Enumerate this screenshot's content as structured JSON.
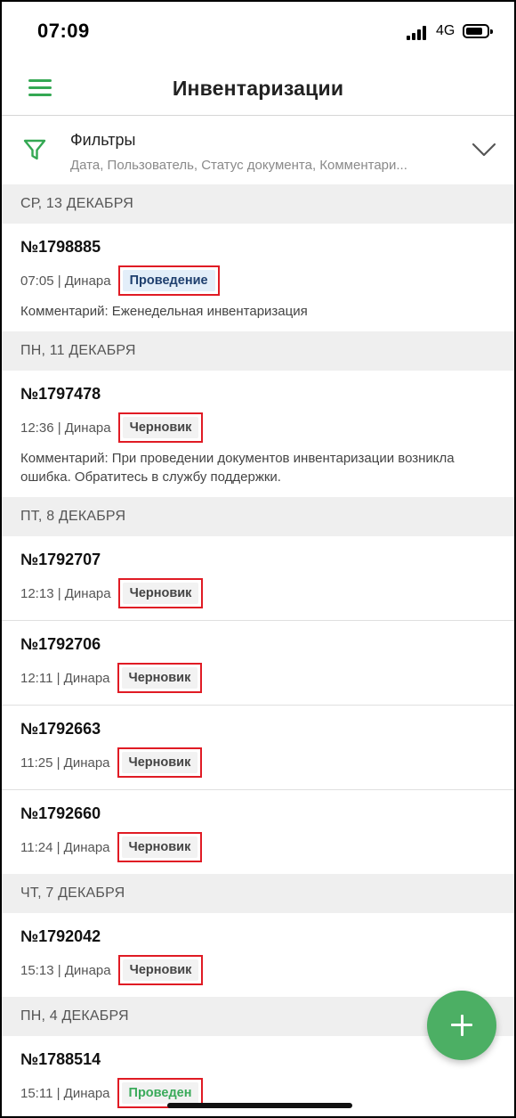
{
  "status_bar": {
    "time": "07:09",
    "network": "4G"
  },
  "app_bar": {
    "title": "Инвентаризации",
    "menu_icon": "hamburger-menu-icon"
  },
  "filters": {
    "title": "Фильтры",
    "subtitle": "Дата, Пользователь, Статус документа, Комментари...",
    "icon": "filter-icon"
  },
  "colors": {
    "accent": "#34a853",
    "fab": "#4caf64",
    "highlight": "#e01b24"
  },
  "groups": [
    {
      "date": "СР, 13 ДЕКАБРЯ",
      "items": [
        {
          "number": "№1798885",
          "meta": "07:05 | Динара",
          "status": "Проведение",
          "status_kind": "processing",
          "comment": "Комментарий: Еженедельная инвентаризация"
        }
      ]
    },
    {
      "date": "ПН, 11 ДЕКАБРЯ",
      "items": [
        {
          "number": "№1797478",
          "meta": "12:36 | Динара",
          "status": "Черновик",
          "status_kind": "draft",
          "comment": "Комментарий: При проведении документов инвентаризации возникла ошибка. Обратитесь в службу поддержки."
        }
      ]
    },
    {
      "date": "ПТ, 8 ДЕКАБРЯ",
      "items": [
        {
          "number": "№1792707",
          "meta": "12:13 | Динара",
          "status": "Черновик",
          "status_kind": "draft",
          "comment": ""
        },
        {
          "number": "№1792706",
          "meta": "12:11 | Динара",
          "status": "Черновик",
          "status_kind": "draft",
          "comment": ""
        },
        {
          "number": "№1792663",
          "meta": "11:25 | Динара",
          "status": "Черновик",
          "status_kind": "draft",
          "comment": ""
        },
        {
          "number": "№1792660",
          "meta": "11:24 | Динара",
          "status": "Черновик",
          "status_kind": "draft",
          "comment": ""
        }
      ]
    },
    {
      "date": "ЧТ, 7 ДЕКАБРЯ",
      "items": [
        {
          "number": "№1792042",
          "meta": "15:13 | Динара",
          "status": "Черновик",
          "status_kind": "draft",
          "comment": ""
        }
      ]
    },
    {
      "date": "ПН, 4 ДЕКАБРЯ",
      "items": [
        {
          "number": "№1788514",
          "meta": "15:11 | Динара",
          "status": "Проведен",
          "status_kind": "done",
          "comment": ""
        }
      ]
    }
  ],
  "fab": {
    "icon": "plus-icon"
  }
}
